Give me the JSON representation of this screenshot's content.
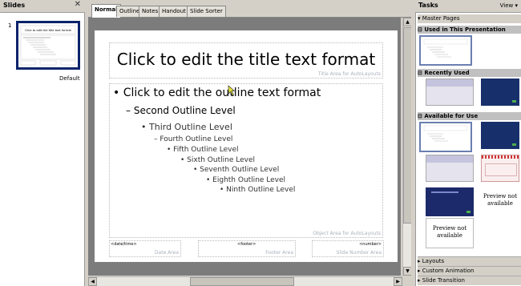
{
  "slides_panel": {
    "title": "Slides",
    "close": "✕",
    "slide_number": "1",
    "slide_caption": "Default",
    "thumb_title": "Click to edit the title text format"
  },
  "tabs": [
    "Normal",
    "Outline",
    "Notes",
    "Handout",
    "Slide Sorter"
  ],
  "slide": {
    "title": "Click to edit the title text format",
    "title_area": "Title Area for AutoLayouts",
    "outline": [
      "Click to edit the outline text format",
      "Second Outline Level",
      "Third Outline Level",
      "Fourth Outline Level",
      "Fifth Outline Level",
      "Sixth Outline Level",
      "Seventh Outline Level",
      "Eighth Outline Level",
      "Ninth Outline Level"
    ],
    "object_area": "Object Area for AutoLayouts",
    "footer": {
      "date_field": "<date/time>",
      "date_area": "Date Area",
      "footer_field": "<footer>",
      "footer_area": "Footer Area",
      "number_field": "<number>",
      "number_area": "Slide Number Area"
    }
  },
  "tasks": {
    "title": "Tasks",
    "view": "View",
    "master_pages": "Master Pages",
    "used": "Used in This Presentation",
    "recent": "Recently Used",
    "available": "Available for Use",
    "preview_na": "Preview not available",
    "layouts": "Layouts",
    "custom_animation": "Custom Animation",
    "slide_transition": "Slide Transition"
  },
  "colors": {
    "accent_navy": "#0a246a",
    "dark_blue_master": "#17306b",
    "lavender_master": "#c5c4de"
  }
}
